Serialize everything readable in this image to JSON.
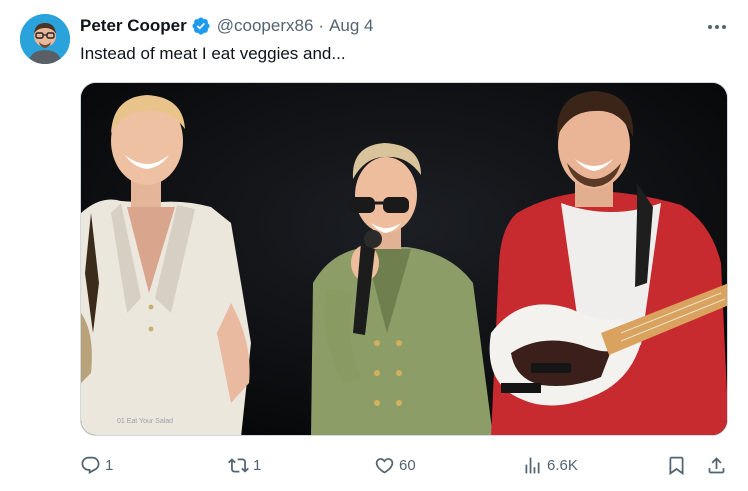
{
  "author": {
    "name": "Peter Cooper",
    "handle": "@cooperx86",
    "separator": "·",
    "date": "Aug 4",
    "verified_color": "#1d9bf0"
  },
  "tweet": {
    "text": "Instead of meat I eat veggies and..."
  },
  "media": {
    "overlay_caption": "01 Eat Your Salad",
    "description_icons": [
      "video-frame"
    ]
  },
  "actions": {
    "reply_count": "1",
    "repost_count": "1",
    "like_count": "60",
    "views_count": "6.6K"
  },
  "colors": {
    "text_primary": "#0f1419",
    "text_secondary": "#536471",
    "accent": "#1d9bf0"
  }
}
